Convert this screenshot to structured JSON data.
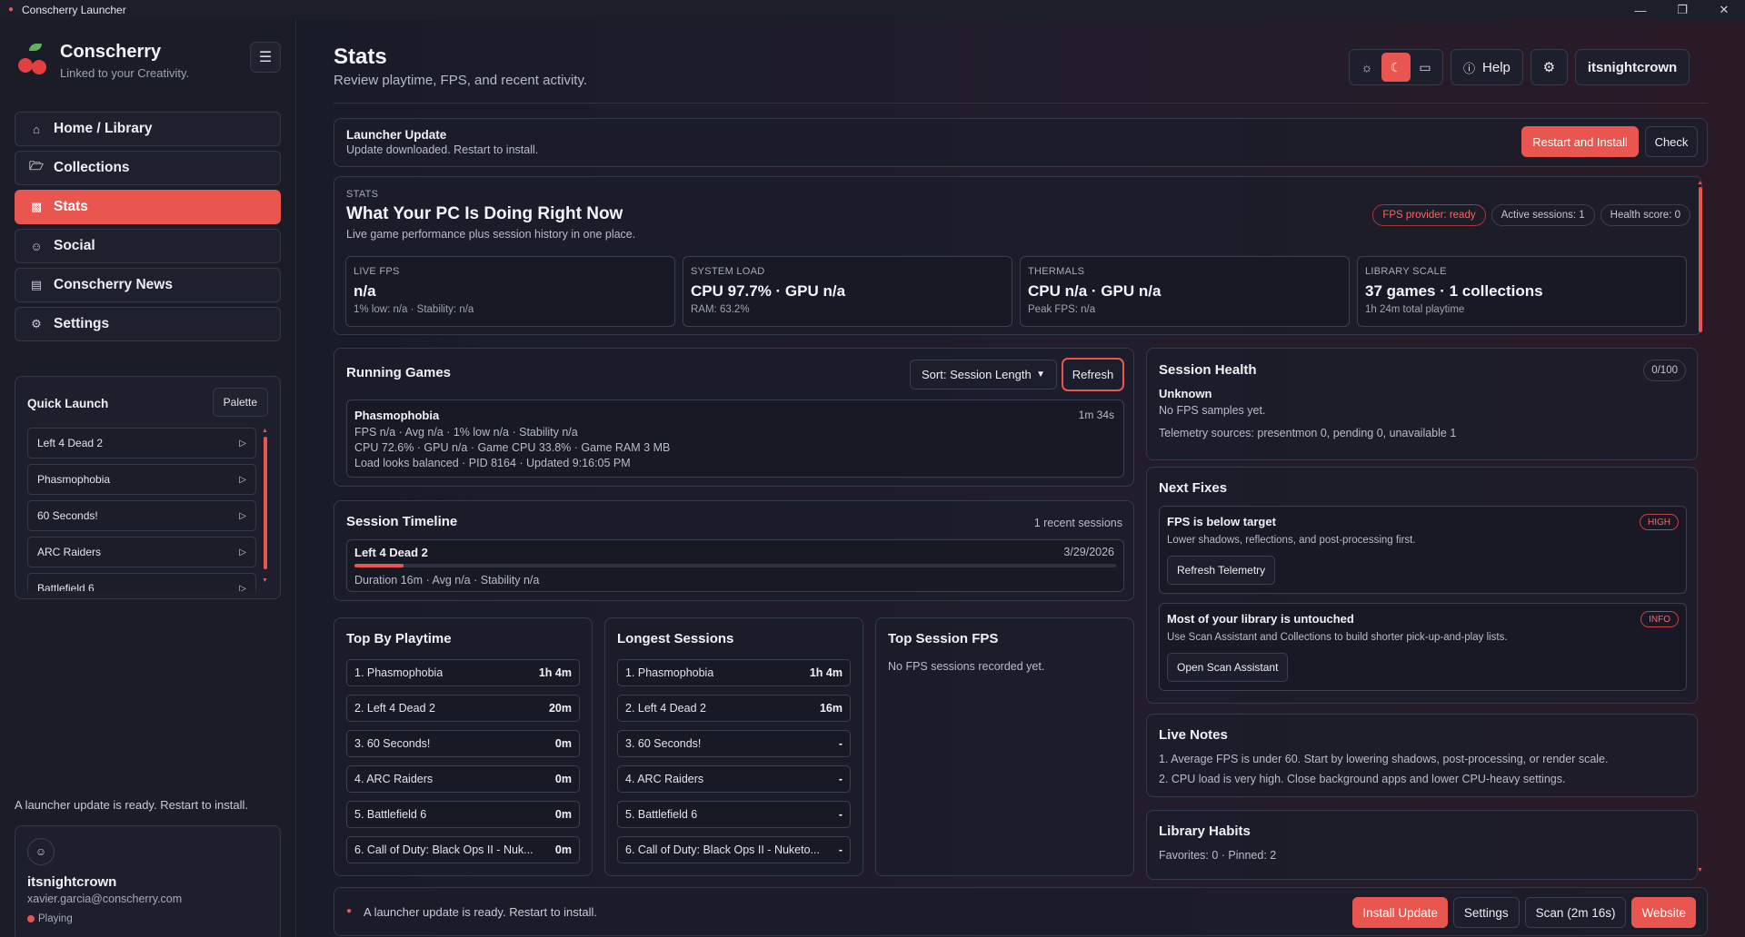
{
  "window": {
    "title": "Conscherry Launcher",
    "controls": [
      "minimize-icon",
      "restore-icon",
      "close-icon"
    ]
  },
  "brand": {
    "name": "Conscherry",
    "tagline": "Linked to your Creativity."
  },
  "nav": [
    {
      "label": "Home / Library",
      "icon": "home-icon",
      "active": false
    },
    {
      "label": "Collections",
      "icon": "folder-icon",
      "active": false
    },
    {
      "label": "Stats",
      "icon": "bar-chart-icon",
      "active": true
    },
    {
      "label": "Social",
      "icon": "user-icon",
      "active": false
    },
    {
      "label": "Conscherry News",
      "icon": "news-icon",
      "active": false
    },
    {
      "label": "Settings",
      "icon": "gear-icon",
      "active": false
    }
  ],
  "quick_launch": {
    "title": "Quick Launch",
    "palette_label": "Palette",
    "items": [
      "Left 4 Dead 2",
      "Phasmophobia",
      "60 Seconds!",
      "ARC Raiders",
      "Battlefield 6"
    ]
  },
  "sidebar_note": "A launcher update is ready. Restart to install.",
  "user": {
    "name": "itsnightcrown",
    "email": "xavier.garcia@conscherry.com",
    "status": "Playing"
  },
  "header": {
    "title": "Stats",
    "subtitle": "Review playtime, FPS, and recent activity.",
    "help_label": "Help",
    "username": "itsnightcrown"
  },
  "update": {
    "title": "Launcher Update",
    "desc": "Update downloaded. Restart to install.",
    "restart_label": "Restart and Install",
    "check_label": "Check"
  },
  "stats": {
    "eyebrow": "STATS",
    "heading": "What Your PC Is Doing Right Now",
    "sub": "Live game performance plus session history in one place.",
    "pills": [
      "FPS provider: ready",
      "Active sessions: 1",
      "Health score: 0"
    ],
    "metrics": [
      {
        "label": "LIVE FPS",
        "value": "n/a",
        "sub": "1% low: n/a · Stability: n/a"
      },
      {
        "label": "SYSTEM LOAD",
        "value": "CPU 97.7% · GPU n/a",
        "sub": "RAM: 63.2%"
      },
      {
        "label": "THERMALS",
        "value": "CPU n/a · GPU n/a",
        "sub": "Peak FPS: n/a"
      },
      {
        "label": "LIBRARY SCALE",
        "value": "37 games · 1 collections",
        "sub": "1h 24m total playtime"
      }
    ]
  },
  "running": {
    "title": "Running Games",
    "sort_label": "Sort: Session Length",
    "refresh_label": "Refresh",
    "game": {
      "name": "Phasmophobia",
      "time": "1m 34s",
      "line1": "FPS n/a · Avg n/a · 1% low n/a · Stability n/a",
      "line2": "CPU 72.6% · GPU n/a · Game CPU 33.8% · Game RAM 3 MB",
      "line3": "Load looks balanced · PID 8164 · Updated 9:16:05 PM"
    }
  },
  "timeline": {
    "title": "Session Timeline",
    "count": "1 recent sessions",
    "session": {
      "name": "Left 4 Dead 2",
      "date": "3/29/2026",
      "detail": "Duration 16m · Avg n/a · Stability n/a",
      "progress": 0.065
    }
  },
  "top_playtime": {
    "title": "Top By Playtime",
    "rows": [
      {
        "name": "1. Phasmophobia",
        "value": "1h 4m"
      },
      {
        "name": "2. Left 4 Dead 2",
        "value": "20m"
      },
      {
        "name": "3. 60 Seconds!",
        "value": "0m"
      },
      {
        "name": "4. ARC Raiders",
        "value": "0m"
      },
      {
        "name": "5. Battlefield 6",
        "value": "0m"
      },
      {
        "name": "6. Call of Duty: Black Ops II - Nuk...",
        "value": "0m"
      }
    ]
  },
  "longest": {
    "title": "Longest Sessions",
    "rows": [
      {
        "name": "1. Phasmophobia",
        "value": "1h 4m"
      },
      {
        "name": "2. Left 4 Dead 2",
        "value": "16m"
      },
      {
        "name": "3. 60 Seconds!",
        "value": "-"
      },
      {
        "name": "4. ARC Raiders",
        "value": "-"
      },
      {
        "name": "5. Battlefield 6",
        "value": "-"
      },
      {
        "name": "6. Call of Duty: Black Ops II - Nuketo...",
        "value": "-"
      }
    ]
  },
  "top_fps": {
    "title": "Top Session FPS",
    "empty": "No FPS sessions recorded yet."
  },
  "health": {
    "title": "Session Health",
    "score": "0/100",
    "status": "Unknown",
    "line1": "No FPS samples yet.",
    "line2": "Telemetry sources: presentmon 0, pending 0, unavailable 1"
  },
  "fixes": {
    "title": "Next Fixes",
    "items": [
      {
        "title": "FPS is below target",
        "badge": "HIGH",
        "desc": "Lower shadows, reflections, and post-processing first.",
        "button": "Refresh Telemetry"
      },
      {
        "title": "Most of your library is untouched",
        "badge": "INFO",
        "desc": "Use Scan Assistant and Collections to build shorter pick-up-and-play lists.",
        "button": "Open Scan Assistant"
      }
    ]
  },
  "notes": {
    "title": "Live Notes",
    "items": [
      "1. Average FPS is under 60. Start by lowering shadows, post-processing, or render scale.",
      "2. CPU load is very high. Close background apps and lower CPU-heavy settings."
    ]
  },
  "habits": {
    "title": "Library Habits",
    "line": "Favorites: 0 · Pinned: 2"
  },
  "footer": {
    "text": "A launcher update is ready. Restart to install.",
    "install_label": "Install Update",
    "settings_label": "Settings",
    "scan_label": "Scan (2m 16s)",
    "website_label": "Website"
  },
  "colors": {
    "accent": "#e9554f",
    "background": "#14161f",
    "panel": "#1d202c"
  }
}
